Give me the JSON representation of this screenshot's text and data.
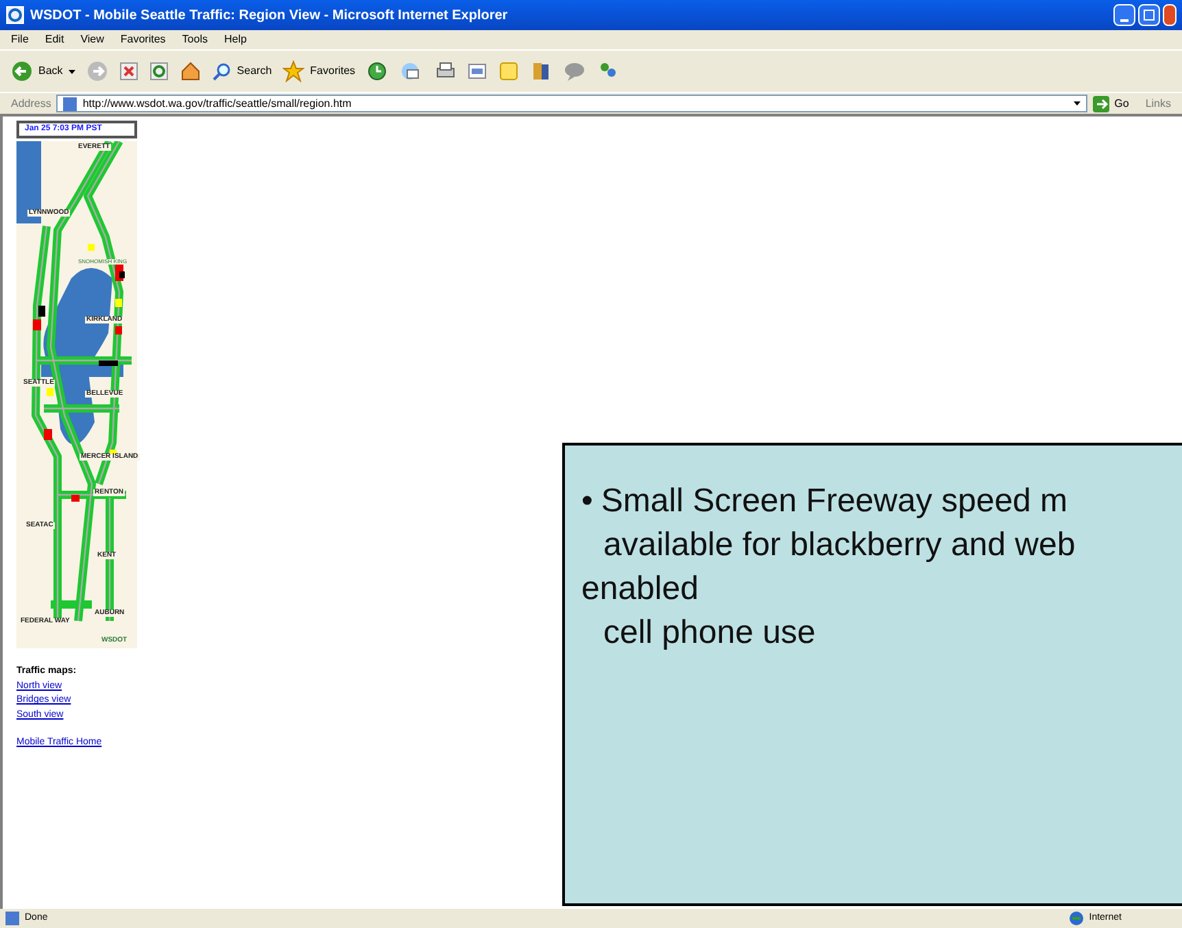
{
  "window": {
    "title": "WSDOT - Mobile Seattle Traffic: Region View - Microsoft Internet Explorer"
  },
  "menu": [
    "File",
    "Edit",
    "View",
    "Favorites",
    "Tools",
    "Help"
  ],
  "toolbar": {
    "back": "Back",
    "search": "Search",
    "favorites": "Favorites"
  },
  "address_bar": {
    "label": "Address",
    "value": "http://www.wsdot.wa.gov/traffic/seattle/small/region.htm",
    "go": "Go",
    "links": "Links"
  },
  "page": {
    "timestamp": "Jan 25 7:03 PM PST",
    "map_labels": [
      {
        "text": "EVERETT",
        "kind": "city"
      },
      {
        "text": "LYNNWOOD",
        "kind": "city"
      },
      {
        "text": "SNOHOMISH KING",
        "kind": "county"
      },
      {
        "text": "KIRKLAND",
        "kind": "city"
      },
      {
        "text": "SEATTLE",
        "kind": "city"
      },
      {
        "text": "BELLEVUE",
        "kind": "city"
      },
      {
        "text": "MERCER ISLAND",
        "kind": "city"
      },
      {
        "text": "RENTON",
        "kind": "city"
      },
      {
        "text": "SEATAC",
        "kind": "city"
      },
      {
        "text": "KENT",
        "kind": "city"
      },
      {
        "text": "AUBURN",
        "kind": "city"
      },
      {
        "text": "FEDERAL WAY",
        "kind": "city"
      },
      {
        "text": "WSDOT",
        "kind": "logo"
      }
    ],
    "heading": "Traffic maps:",
    "links": [
      "North view",
      "Bridges view",
      "South view"
    ],
    "home_link": "Mobile Traffic Home"
  },
  "callout": {
    "bullet": "•",
    "lines": [
      "Small Screen Freeway speed m",
      "available for blackberry and web",
      "enabled",
      "cell phone use"
    ]
  },
  "status_bar": {
    "text": "Done",
    "zone": "Internet"
  }
}
